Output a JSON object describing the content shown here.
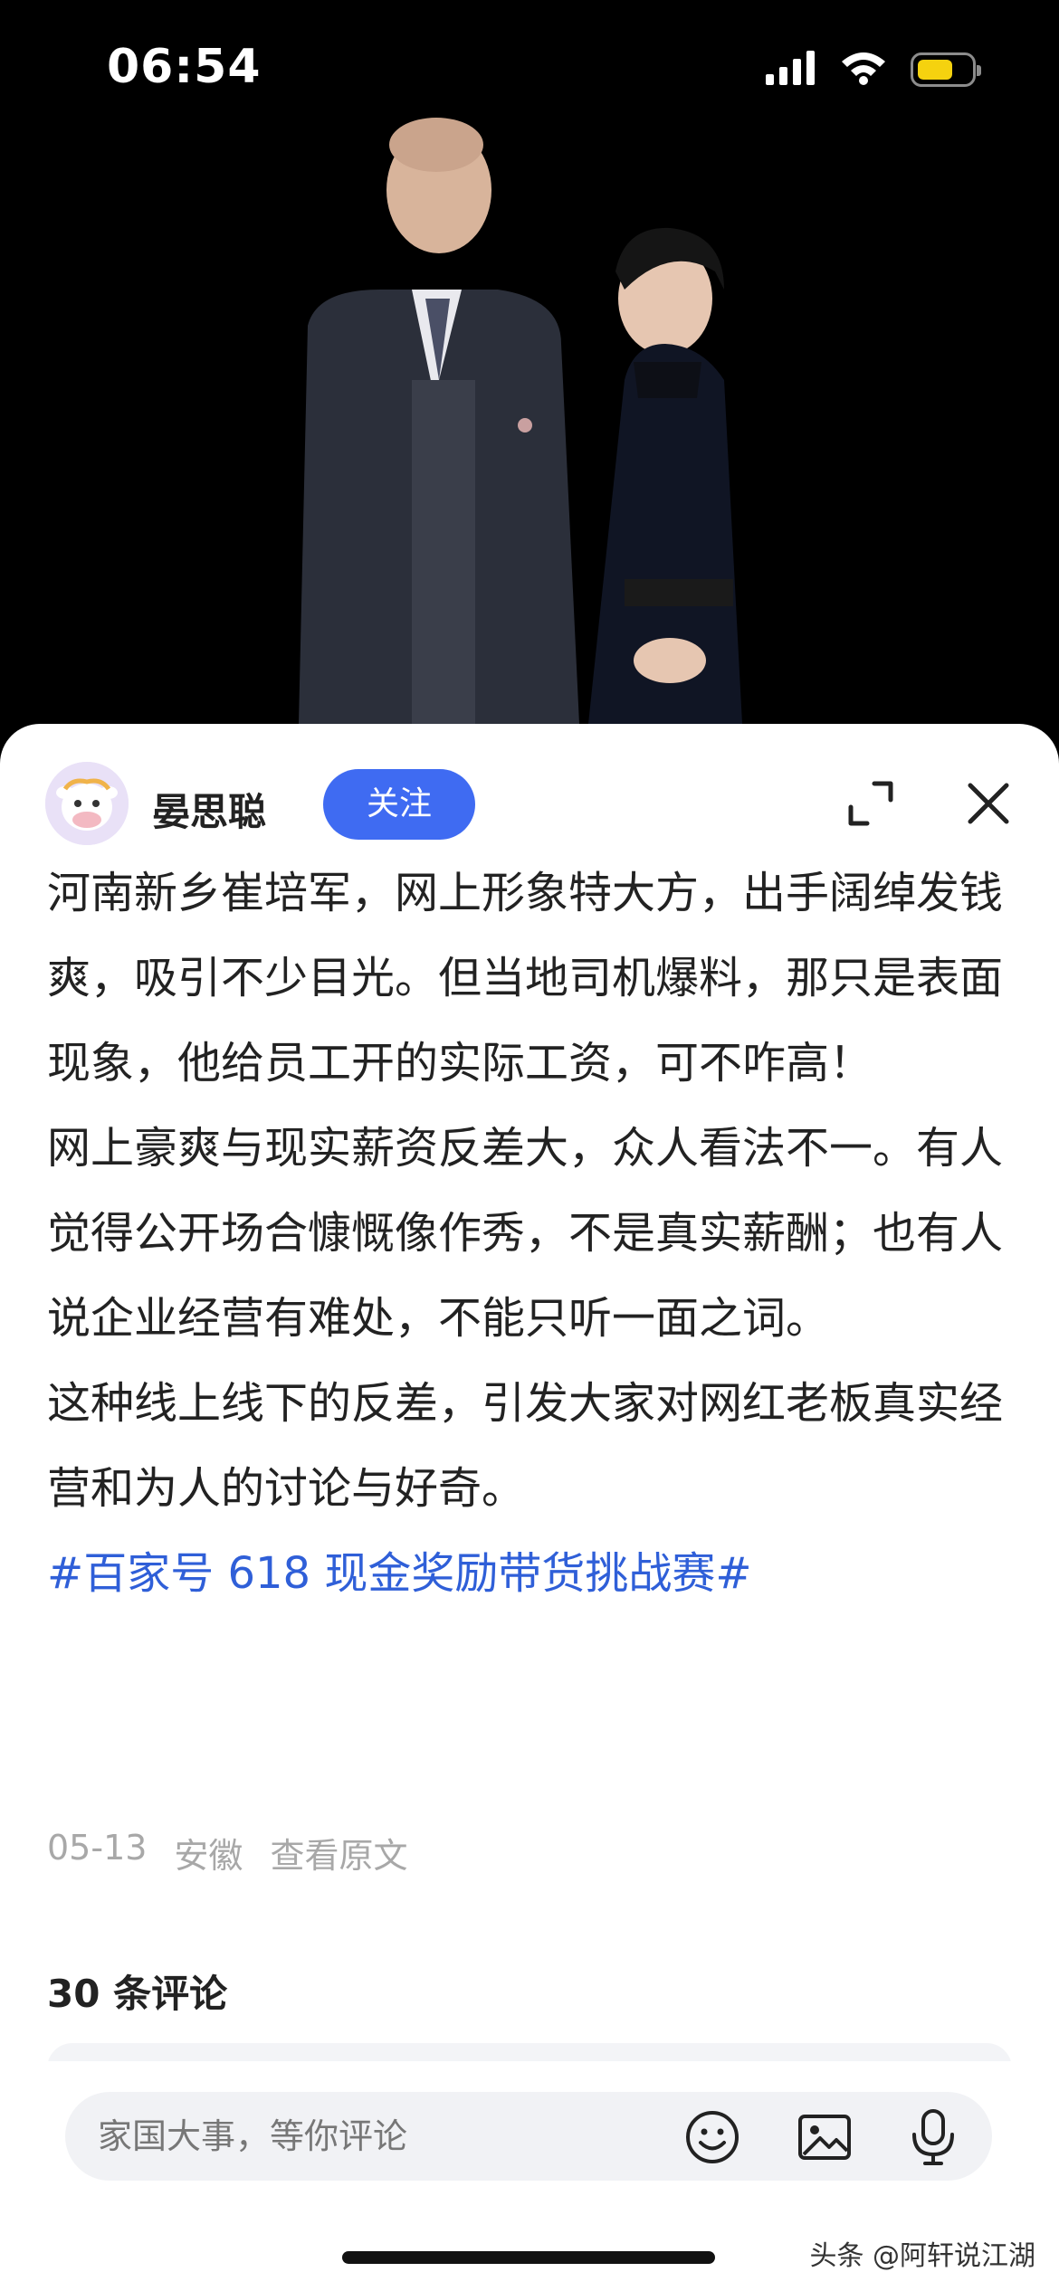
{
  "status_bar": {
    "time": "06:54",
    "icons": [
      "cellular-signal-icon",
      "wifi-icon",
      "battery-icon"
    ],
    "battery_color": "#f5d20f"
  },
  "header": {
    "author_name": "晏思聪",
    "follow_label": "关注",
    "follow_color": "#3f6bf2"
  },
  "post": {
    "paragraphs": [
      "河南新乡崔培军，网上形象特大方，出手阔绰发钱爽，吸引不少目光。但当地司机爆料，那只是表面现象，他给员工开的实际工资，可不咋高！",
      "网上豪爽与现实薪资反差大，众人看法不一。有人觉得公开场合慷慨像作秀，不是真实薪酬；也有人说企业经营有难处，不能只听一面之词。",
      "这种线上线下的反差，引发大家对网红老板真实经营和为人的讨论与好奇。"
    ],
    "hashtag": "#百家号 618 现金奖励带货挑战赛#",
    "hashtag_color": "#2f5fd8",
    "date": "05-13",
    "location": "安徽",
    "view_original": "查看原文"
  },
  "comments": {
    "title": "30 条评论"
  },
  "bottom_bar": {
    "placeholder": "家国大事，等你评论",
    "icons": [
      "emoji-icon",
      "image-icon",
      "microphone-icon"
    ]
  },
  "watermark": "头条 @阿轩说江湖"
}
